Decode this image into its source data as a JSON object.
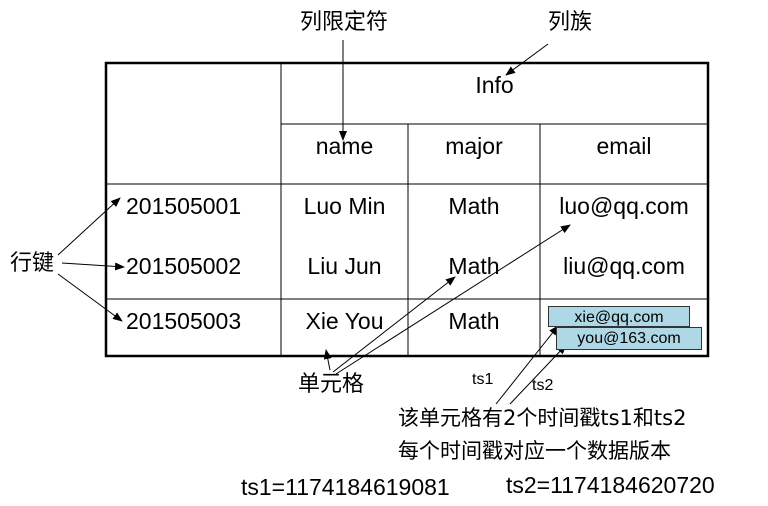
{
  "annotations": {
    "column_qualifier": "列限定符",
    "column_family": "列族",
    "row_key": "行键",
    "cell": "单元格",
    "ts1_tag": "ts1",
    "ts2_tag": "ts2",
    "note_line1": "该单元格有2个时间戳ts1和ts2",
    "note_line2": "每个时间戳对应一个数据版本",
    "ts1_value": "ts1=1174184619081",
    "ts2_value": "ts2=1174184620720"
  },
  "table": {
    "family": "Info",
    "columns": [
      "name",
      "major",
      "email"
    ],
    "rows": [
      {
        "key": "201505001",
        "name": "Luo Min",
        "major": "Math",
        "email": "luo@qq.com"
      },
      {
        "key": "201505002",
        "name": "Liu Jun",
        "major": "Math",
        "email": "liu@qq.com"
      },
      {
        "key": "201505003",
        "name": "Xie You",
        "major": "Math",
        "versions": [
          "xie@qq.com",
          "you@163.com"
        ]
      }
    ]
  }
}
